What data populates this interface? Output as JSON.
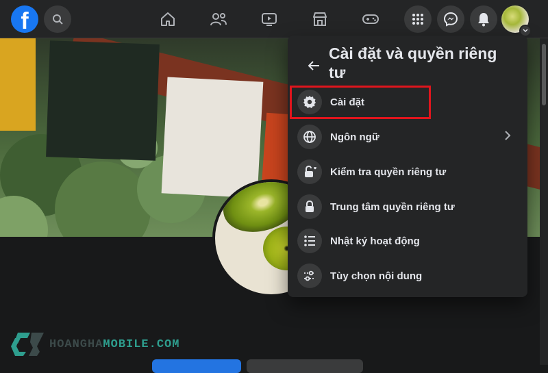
{
  "topbar": {
    "logo_letter": "f",
    "nav": [
      {
        "name": "home"
      },
      {
        "name": "friends"
      },
      {
        "name": "watch"
      },
      {
        "name": "marketplace"
      },
      {
        "name": "gaming"
      }
    ]
  },
  "settings_menu": {
    "title": "Cài đặt và quyền riêng tư",
    "items": [
      {
        "label": "Cài đặt",
        "icon": "gear-icon"
      },
      {
        "label": "Ngôn ngữ",
        "icon": "globe-icon",
        "has_submenu": true
      },
      {
        "label": "Kiểm tra quyền riêng tư",
        "icon": "lock-heart-icon"
      },
      {
        "label": "Trung tâm quyền riêng tư",
        "icon": "lock-icon"
      },
      {
        "label": "Nhật ký hoạt động",
        "icon": "list-icon"
      },
      {
        "label": "Tùy chọn nội dung",
        "icon": "sliders-icon"
      }
    ],
    "highlighted_item": "Cài đặt"
  },
  "watermark": {
    "part1": "HOANGHA",
    "part2": "MOBILE.COM"
  },
  "colors": {
    "accent": "#1877f2",
    "highlight_box": "#e0151d",
    "menu_bg": "#242526",
    "page_bg": "#18191a"
  }
}
